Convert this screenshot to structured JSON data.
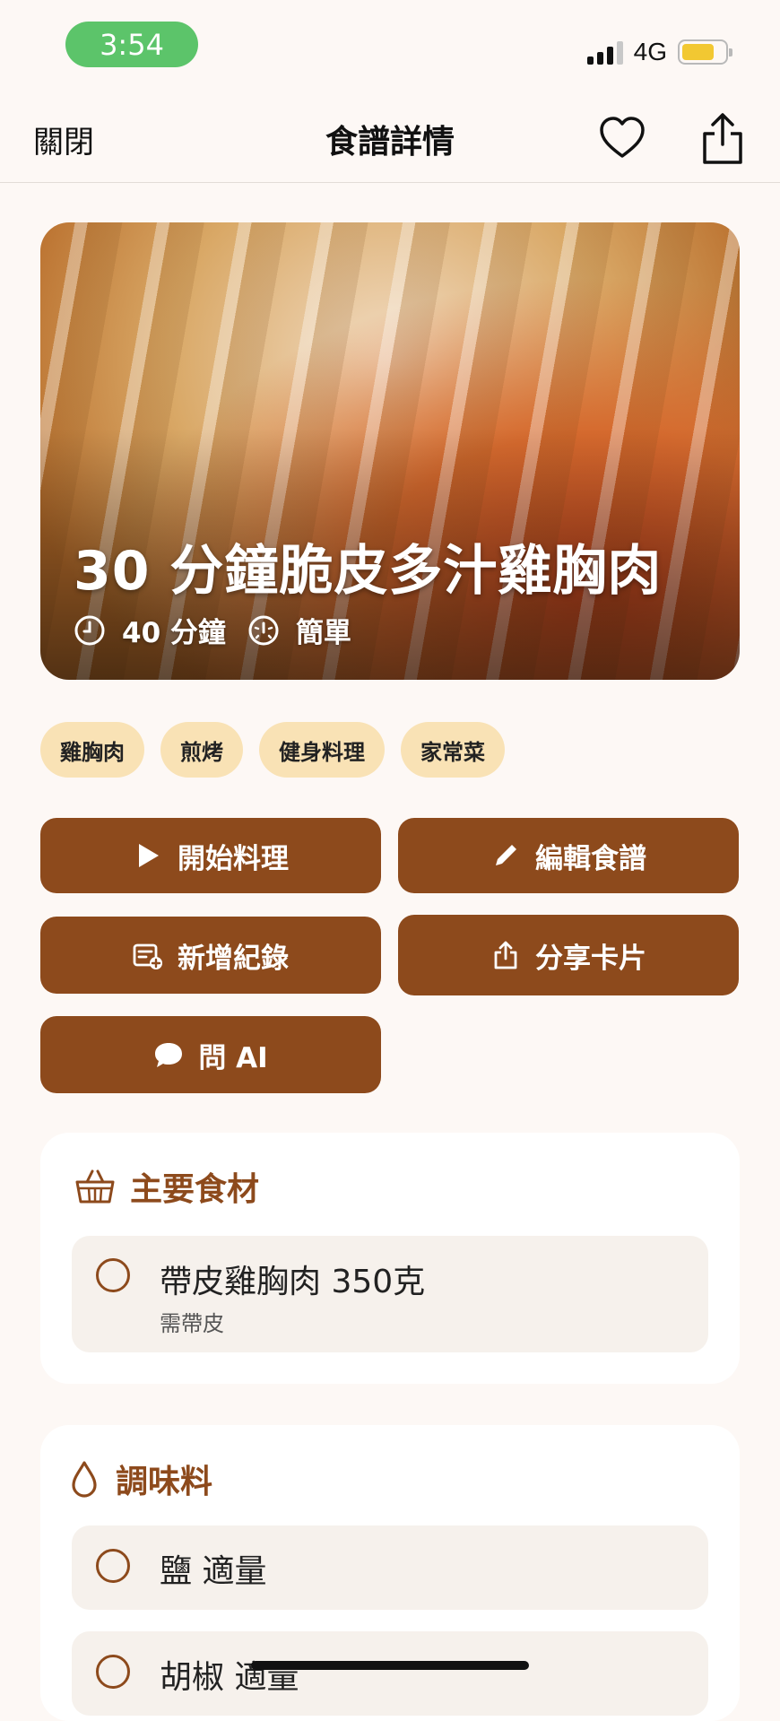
{
  "status_bar": {
    "time": "3:54",
    "network": "4G",
    "battery_level": 0.75
  },
  "nav": {
    "close_label": "關閉",
    "title": "食譜詳情"
  },
  "hero": {
    "title": "30 分鐘脆皮多汁雞胸肉",
    "time": "40 分鐘",
    "difficulty": "簡單"
  },
  "tags": [
    "雞胸肉",
    "煎烤",
    "健身料理",
    "家常菜"
  ],
  "actions": {
    "start_cooking": "開始料理",
    "edit_recipe": "編輯食譜",
    "add_record": "新增紀錄",
    "share_card": "分享卡片",
    "ask_ai": "問 AI"
  },
  "main_ingredients": {
    "title": "主要食材",
    "items": [
      {
        "name": "帶皮雞胸肉 350克",
        "note": "需帶皮"
      }
    ]
  },
  "seasonings": {
    "title": "調味料",
    "items": [
      {
        "name": "鹽 適量"
      },
      {
        "name": "胡椒 適量"
      }
    ]
  },
  "colors": {
    "accent": "#8d4a1c",
    "tag_bg": "#f9e2b5",
    "background": "#fdf8f5",
    "time_pill": "#5cc46a"
  }
}
